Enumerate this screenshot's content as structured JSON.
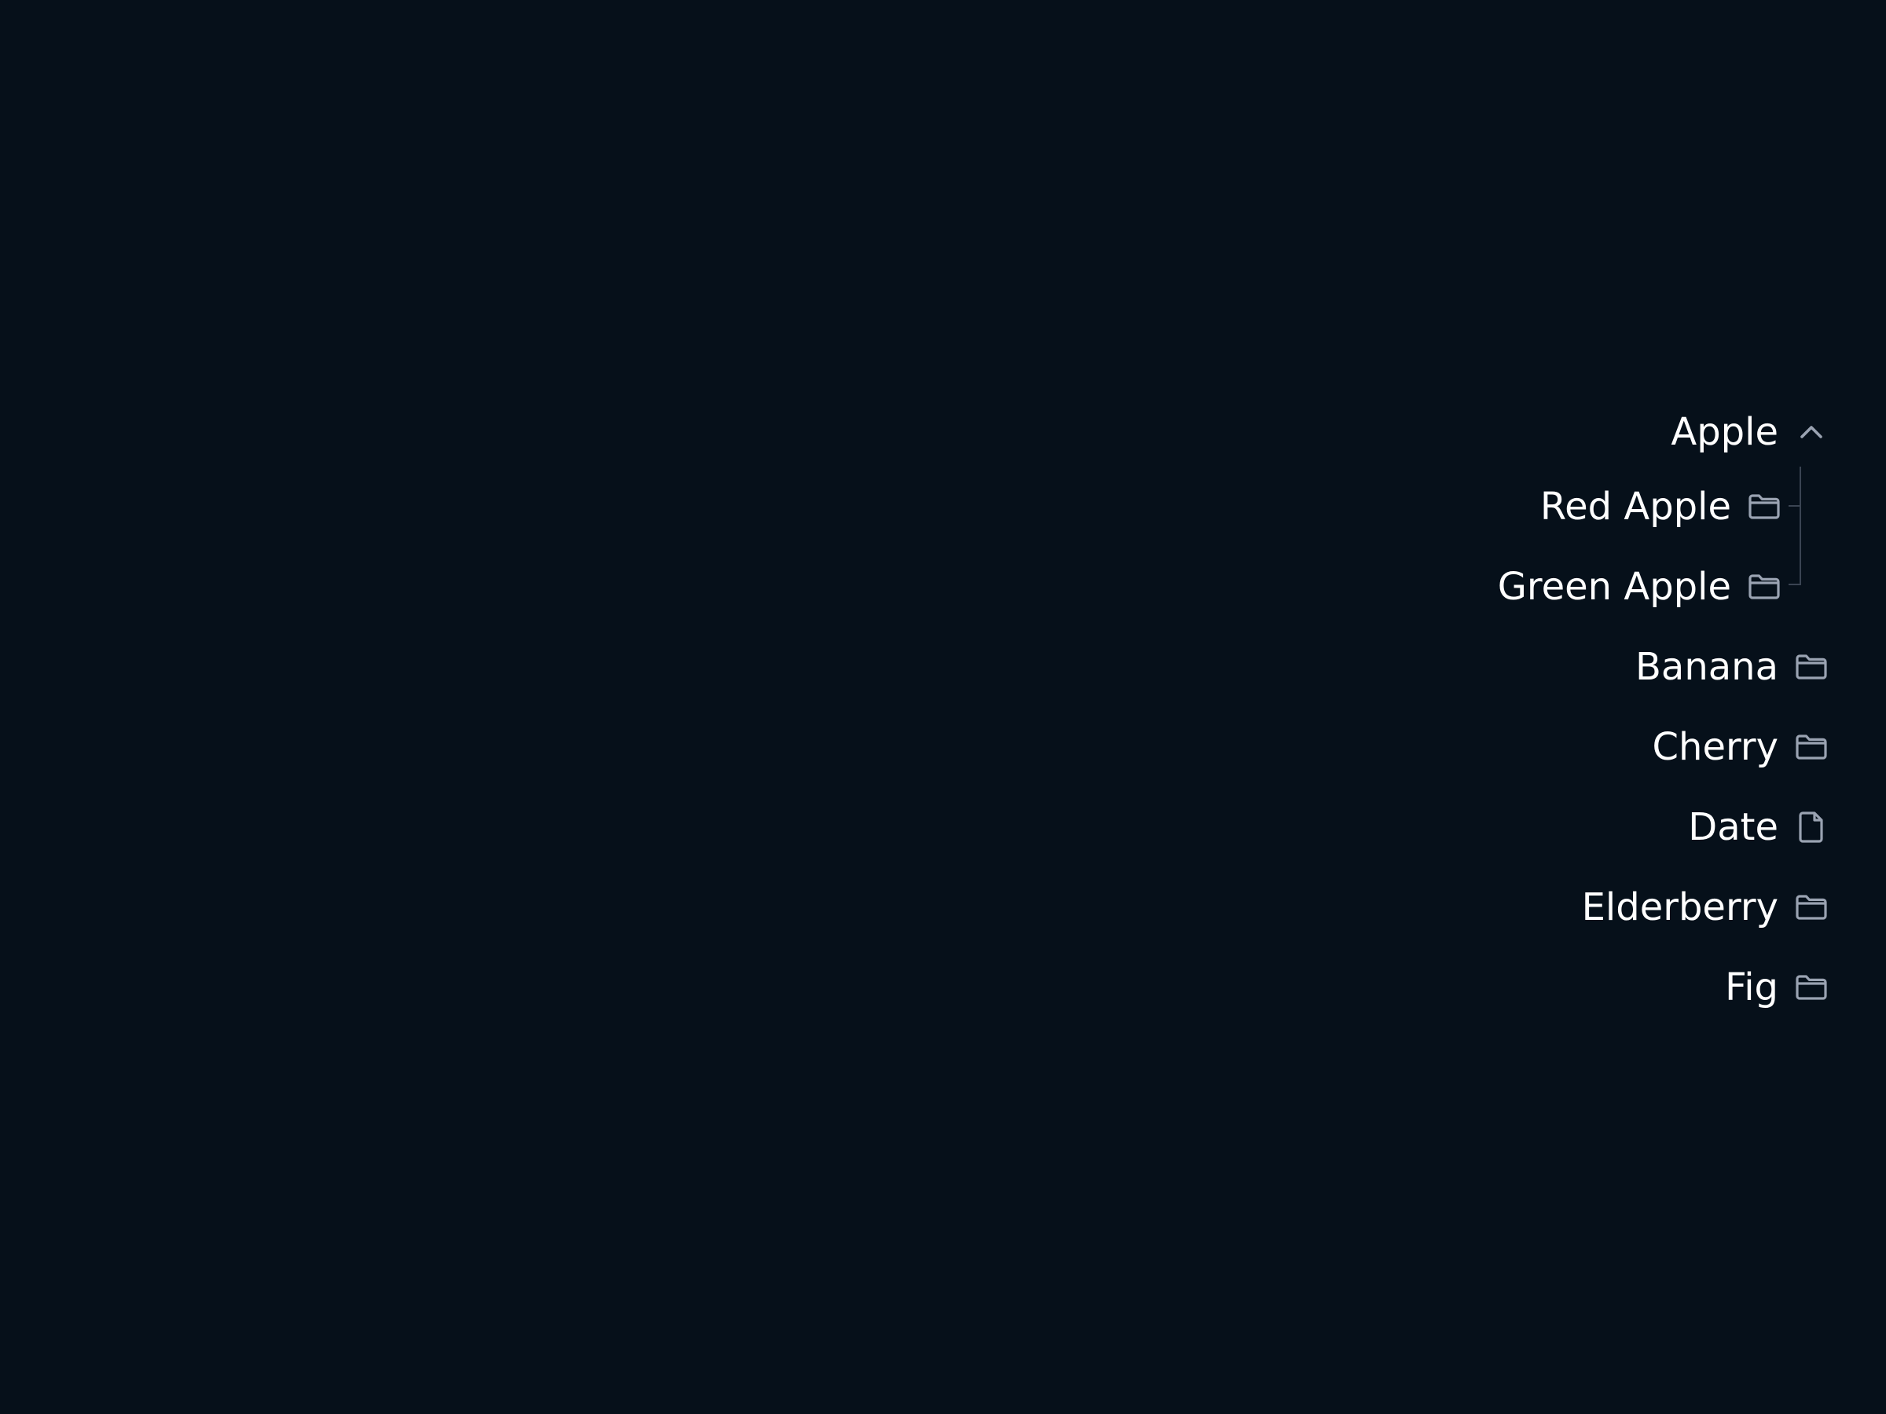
{
  "tree": {
    "items": [
      {
        "label": "Apple",
        "icon": "chevron-up-icon",
        "expanded": true,
        "children": [
          {
            "label": "Red Apple",
            "icon": "folder-icon"
          },
          {
            "label": "Green Apple",
            "icon": "folder-icon"
          }
        ]
      },
      {
        "label": "Banana",
        "icon": "folder-icon"
      },
      {
        "label": "Cherry",
        "icon": "folder-icon"
      },
      {
        "label": "Date",
        "icon": "file-icon"
      },
      {
        "label": "Elderberry",
        "icon": "folder-icon"
      },
      {
        "label": "Fig",
        "icon": "folder-icon"
      }
    ]
  },
  "colors": {
    "background": "#06101a",
    "text": "#ffffff",
    "icon": "#9aa3b2",
    "guide": "#3a4452"
  }
}
